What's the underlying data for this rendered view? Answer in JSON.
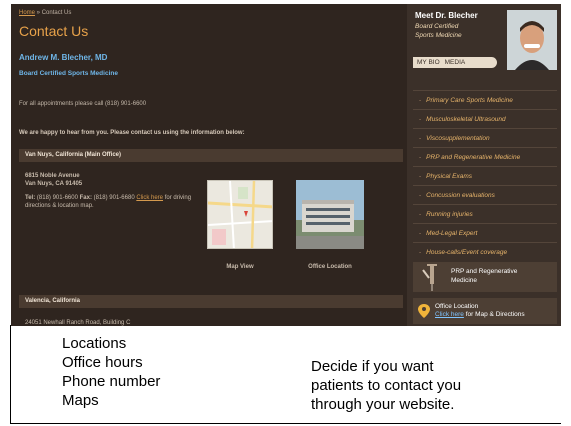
{
  "breadcrumb": {
    "home": "Home",
    "separator": " » ",
    "current": "Contact Us"
  },
  "page_title": "Contact Us",
  "doctor_name": "Andrew M. Blecher, MD",
  "doctor_credential": "Board Certified Sports Medicine",
  "appointment_text": "For all appointments please call (818) 901-6600",
  "intro_text": "We are happy to hear from you. Please contact us using the information below:",
  "offices": [
    {
      "header": "Van Nuys, California (Main Office)",
      "address_line1": "6815 Noble Avenue",
      "address_line2": "Van Nuys, CA 91405",
      "tel_label": "Tel:",
      "tel": "(818) 901-6600",
      "fax_label": "Fax:",
      "fax": "(818) 901-6680",
      "click_link": "Click here",
      "directions_text": "for driving directions & location map.",
      "map_caption": "Map View",
      "photo_caption": "Office Location"
    },
    {
      "header": "Valencia, California",
      "address_line1": "24051 Newhall Ranch Road, Building C"
    }
  ],
  "sidebar": {
    "meet_title": "Meet Dr. Blecher",
    "meet_sub1": "Board Certified",
    "meet_sub2": "Sports Medicine",
    "tab_bio": "MY BIO",
    "tab_media": "MEDIA",
    "nav_dash": "-",
    "nav": [
      "Primary Care Sports Medicine",
      "Musculoskeletal Ultrasound",
      "Viscosupplementation",
      "PRP and Regenerative Medicine",
      "Physical Exams",
      "Concussion evaluations",
      "Running injuries",
      "Med-Legal Expert",
      "House-calls/Event coverage"
    ],
    "promo_line1": "PRP and Regenerative",
    "promo_line2": "Medicine",
    "office_link_title": "Office Location",
    "office_link_click": "Click here",
    "office_link_rest": " for Map & Directions"
  },
  "slide_caption_left": [
    "Locations",
    "Office hours",
    "Phone number",
    "Maps"
  ],
  "slide_caption_right": [
    "Decide if you want",
    "patients to contact you",
    "through your website."
  ]
}
